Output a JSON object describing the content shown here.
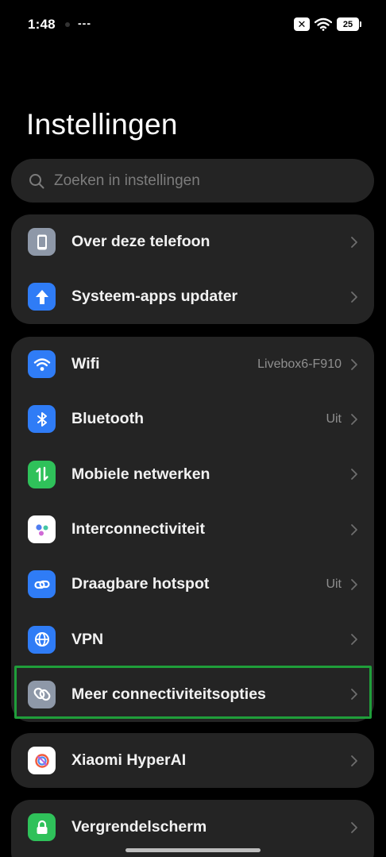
{
  "status_bar": {
    "time": "1:48",
    "dashes": "---",
    "x_icon": "✕",
    "battery": "25"
  },
  "title": "Instellingen",
  "search": {
    "placeholder": "Zoeken in instellingen"
  },
  "groups": [
    {
      "items": [
        {
          "label": "Over deze telefoon",
          "icon": "phone-icon",
          "icon_color": "#8e98a8",
          "value": ""
        },
        {
          "label": "Systeem-apps updater",
          "icon": "arrow-up-icon",
          "icon_color": "#2f7cf6",
          "value": ""
        }
      ]
    },
    {
      "items": [
        {
          "label": "Wifi",
          "icon": "wifi-icon",
          "icon_color": "#2f7cf6",
          "value": "Livebox6-F910"
        },
        {
          "label": "Bluetooth",
          "icon": "bluetooth-icon",
          "icon_color": "#2f7cf6",
          "value": "Uit"
        },
        {
          "label": "Mobiele netwerken",
          "icon": "mobile-data-icon",
          "icon_color": "#2fc15a",
          "value": ""
        },
        {
          "label": "Interconnectiviteit",
          "icon": "interconnect-icon",
          "icon_color": "#ffffff",
          "value": ""
        },
        {
          "label": "Draagbare hotspot",
          "icon": "hotspot-icon",
          "icon_color": "#2f7cf6",
          "value": "Uit"
        },
        {
          "label": "VPN",
          "icon": "globe-icon",
          "icon_color": "#2f7cf6",
          "value": ""
        },
        {
          "label": "Meer connectiviteitsopties",
          "icon": "link-icon",
          "icon_color": "#8e98a8",
          "value": ""
        }
      ]
    },
    {
      "items": [
        {
          "label": "Xiaomi HyperAI",
          "icon": "hyperai-icon",
          "icon_color": "#ffffff",
          "value": ""
        }
      ]
    },
    {
      "items": [
        {
          "label": "Vergrendelscherm",
          "icon": "lock-icon",
          "icon_color": "#2fc15a",
          "value": ""
        }
      ]
    }
  ],
  "colors": {
    "background": "#000000",
    "card": "#242424",
    "highlight": "#1f9e3a"
  }
}
